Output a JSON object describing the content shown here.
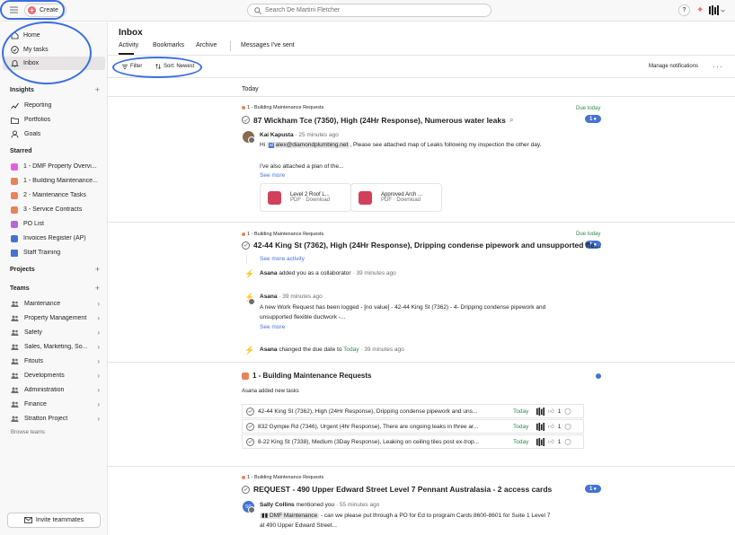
{
  "topbar": {
    "create_label": "Create",
    "search_placeholder": "Search De Martini Fletcher",
    "help_label": "?"
  },
  "sidebar": {
    "nav": [
      {
        "label": "Home",
        "icon": "home-icon"
      },
      {
        "label": "My tasks",
        "icon": "check-circle-icon"
      },
      {
        "label": "Inbox",
        "icon": "bell-icon"
      }
    ],
    "insights_label": "Insights",
    "insights": [
      {
        "label": "Reporting",
        "icon": "chart-line-icon"
      },
      {
        "label": "Portfolios",
        "icon": "folder-icon"
      },
      {
        "label": "Goals",
        "icon": "person-icon"
      }
    ],
    "starred_label": "Starred",
    "starred": [
      {
        "label": "1 - DMF Property Overvi...",
        "color": "#e362e3"
      },
      {
        "label": "1 - Building Maintenance...",
        "color": "#e8845b"
      },
      {
        "label": "2 - Maintenance Tasks",
        "color": "#e8845b"
      },
      {
        "label": "3 - Service Contracts",
        "color": "#e8845b"
      },
      {
        "label": "PO List",
        "color": "#b36bd4"
      },
      {
        "label": "Invoices Register (AP)",
        "color": "#4573d2"
      },
      {
        "label": "Staff Training",
        "color": "#4573d2"
      }
    ],
    "projects_label": "Projects",
    "teams_label": "Teams",
    "teams": [
      "Maintenance",
      "Property Management",
      "Safety",
      "Sales, Marketing, So...",
      "Fitouts",
      "Developments",
      "Administration",
      "Finance",
      "Stratton Project"
    ],
    "browse_label": "Browse teams",
    "invite_label": "Invite teammates"
  },
  "main": {
    "title": "Inbox",
    "tabs": [
      "Activity",
      "Bookmarks",
      "Archive",
      "Messages I've sent"
    ],
    "filter_label": "Filter",
    "sort_label": "Sort: Newest",
    "manage_label": "Manage notifications",
    "more_label": "···",
    "section_label": "Today"
  },
  "feed": {
    "item1": {
      "project": "1 - Building Maintenance Requests",
      "due": "Due today",
      "count": "1",
      "title": "87 Wickham Tce (7350), High (24Hr Response), Numerous water leaks",
      "author": "Kai Kapusta",
      "time": "· 25 minutes ago",
      "greeting": "Hi",
      "mention": "alex@diamondplumbing.net",
      "body": ", Please see attached map of Leaks following my inspection the other day.",
      "body2": "I've also attached a plan of the...",
      "see_more": "See more",
      "attachments": [
        {
          "name": "Level 2 Roof L...",
          "meta": "PDF · Download"
        },
        {
          "name": "Approved Arch ...",
          "meta": "PDF · Download"
        }
      ]
    },
    "item2": {
      "project": "1 - Building Maintenance Requests",
      "due": "Due today",
      "count": "1",
      "title": "42-44 King St (7362), High (24Hr Response), Dripping condense pipework and unsupported fle...",
      "see_more_activity": "See more activity",
      "collab_author": "Asana",
      "collab_text": " added you as a collaborator",
      "collab_time": " · 39 minutes ago",
      "comment_author": "Asana",
      "comment_time": " · 39 minutes ago",
      "comment_body": "A new Work Request has been logged - [no value] - 42-44 King St (7362) - 4- Dripping condense pipework and",
      "comment_body2": "unsupported flexible ductwork -...",
      "see_more": "See more",
      "due_author": "Asana",
      "due_text": " changed the due date to ",
      "due_value": "Today",
      "due_time": " · 39 minutes ago"
    },
    "item3": {
      "title": "1 - Building Maintenance Requests",
      "subtitle": "Asana added new tasks",
      "tasks": [
        {
          "name": "42-44 King St (7362), High (24Hr Response), Dripping condense pipework and uns...",
          "due": "Today",
          "likes": "1"
        },
        {
          "name": "832 Gympie Rd (7346), Urgent (4hr Response), There are ongoing leaks in three ar...",
          "due": "Today",
          "likes": "1"
        },
        {
          "name": "8-22 King St (7338), Medium (3Day Response), Leaking on ceiling tiles post ex-trop...",
          "due": "Today",
          "likes": "1"
        }
      ]
    },
    "item4": {
      "project": "1 - Building Maintenance Requests",
      "count": "1",
      "title": "REQUEST - 490 Upper Edward Street Level 7 Pennant Australasia - 2 access cards",
      "author": "Sally Collins",
      "author_initials": "SC",
      "action": " mentioned you",
      "time": " · 55 minutes ago",
      "mention": "DMF Maintenance",
      "body": " - can we please put through a PO for Ed to program Cards 8600-8601 for Suite 1 Level 7",
      "body2": "at 490 Upper Edward Street..."
    }
  },
  "colors": {
    "accent": "#4573d2",
    "brand": "#f06a6a",
    "highlight_ring": "#3b6fe0"
  }
}
